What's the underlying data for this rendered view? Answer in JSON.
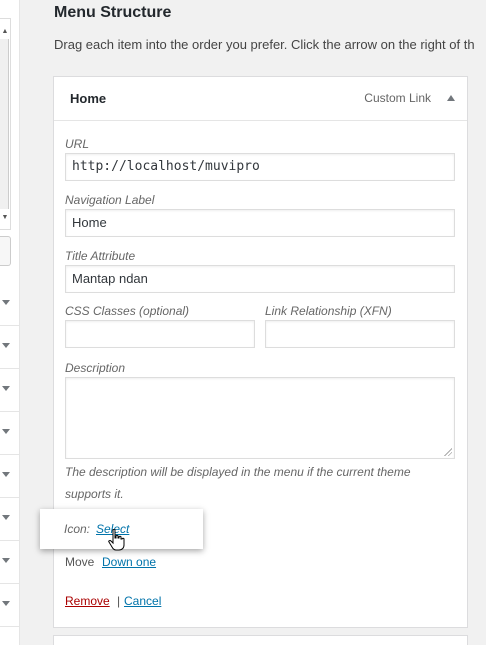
{
  "header": {
    "title": "Menu Structure",
    "description": "Drag each item into the order you prefer. Click the arrow on the right of th"
  },
  "menu_item": {
    "title": "Home",
    "type": "Custom Link",
    "fields": {
      "url": {
        "label": "URL",
        "value": "http://localhost/muvipro"
      },
      "nav_label": {
        "label": "Navigation Label",
        "value": "Home"
      },
      "title_attr": {
        "label": "Title Attribute",
        "value": "Mantap ndan"
      },
      "css_classes": {
        "label": "CSS Classes (optional)",
        "value": ""
      },
      "xfn": {
        "label": "Link Relationship (XFN)",
        "value": ""
      },
      "description": {
        "label": "Description",
        "value": ""
      }
    },
    "help_text": "The description will be displayed in the menu if the current theme supports it.",
    "icon": {
      "label": "Icon:",
      "link": "Select"
    },
    "move": {
      "label": "Move",
      "link": "Down one"
    },
    "actions": {
      "remove": "Remove",
      "separator": "|",
      "cancel": "Cancel"
    }
  },
  "icons": {
    "toggle": "arrow-up-icon",
    "left_rows": "arrow-down-icon",
    "cursor": "hand-pointer-icon"
  },
  "colors": {
    "link": "#0073aa",
    "remove": "#aa0000",
    "background": "#f1f1f1"
  }
}
